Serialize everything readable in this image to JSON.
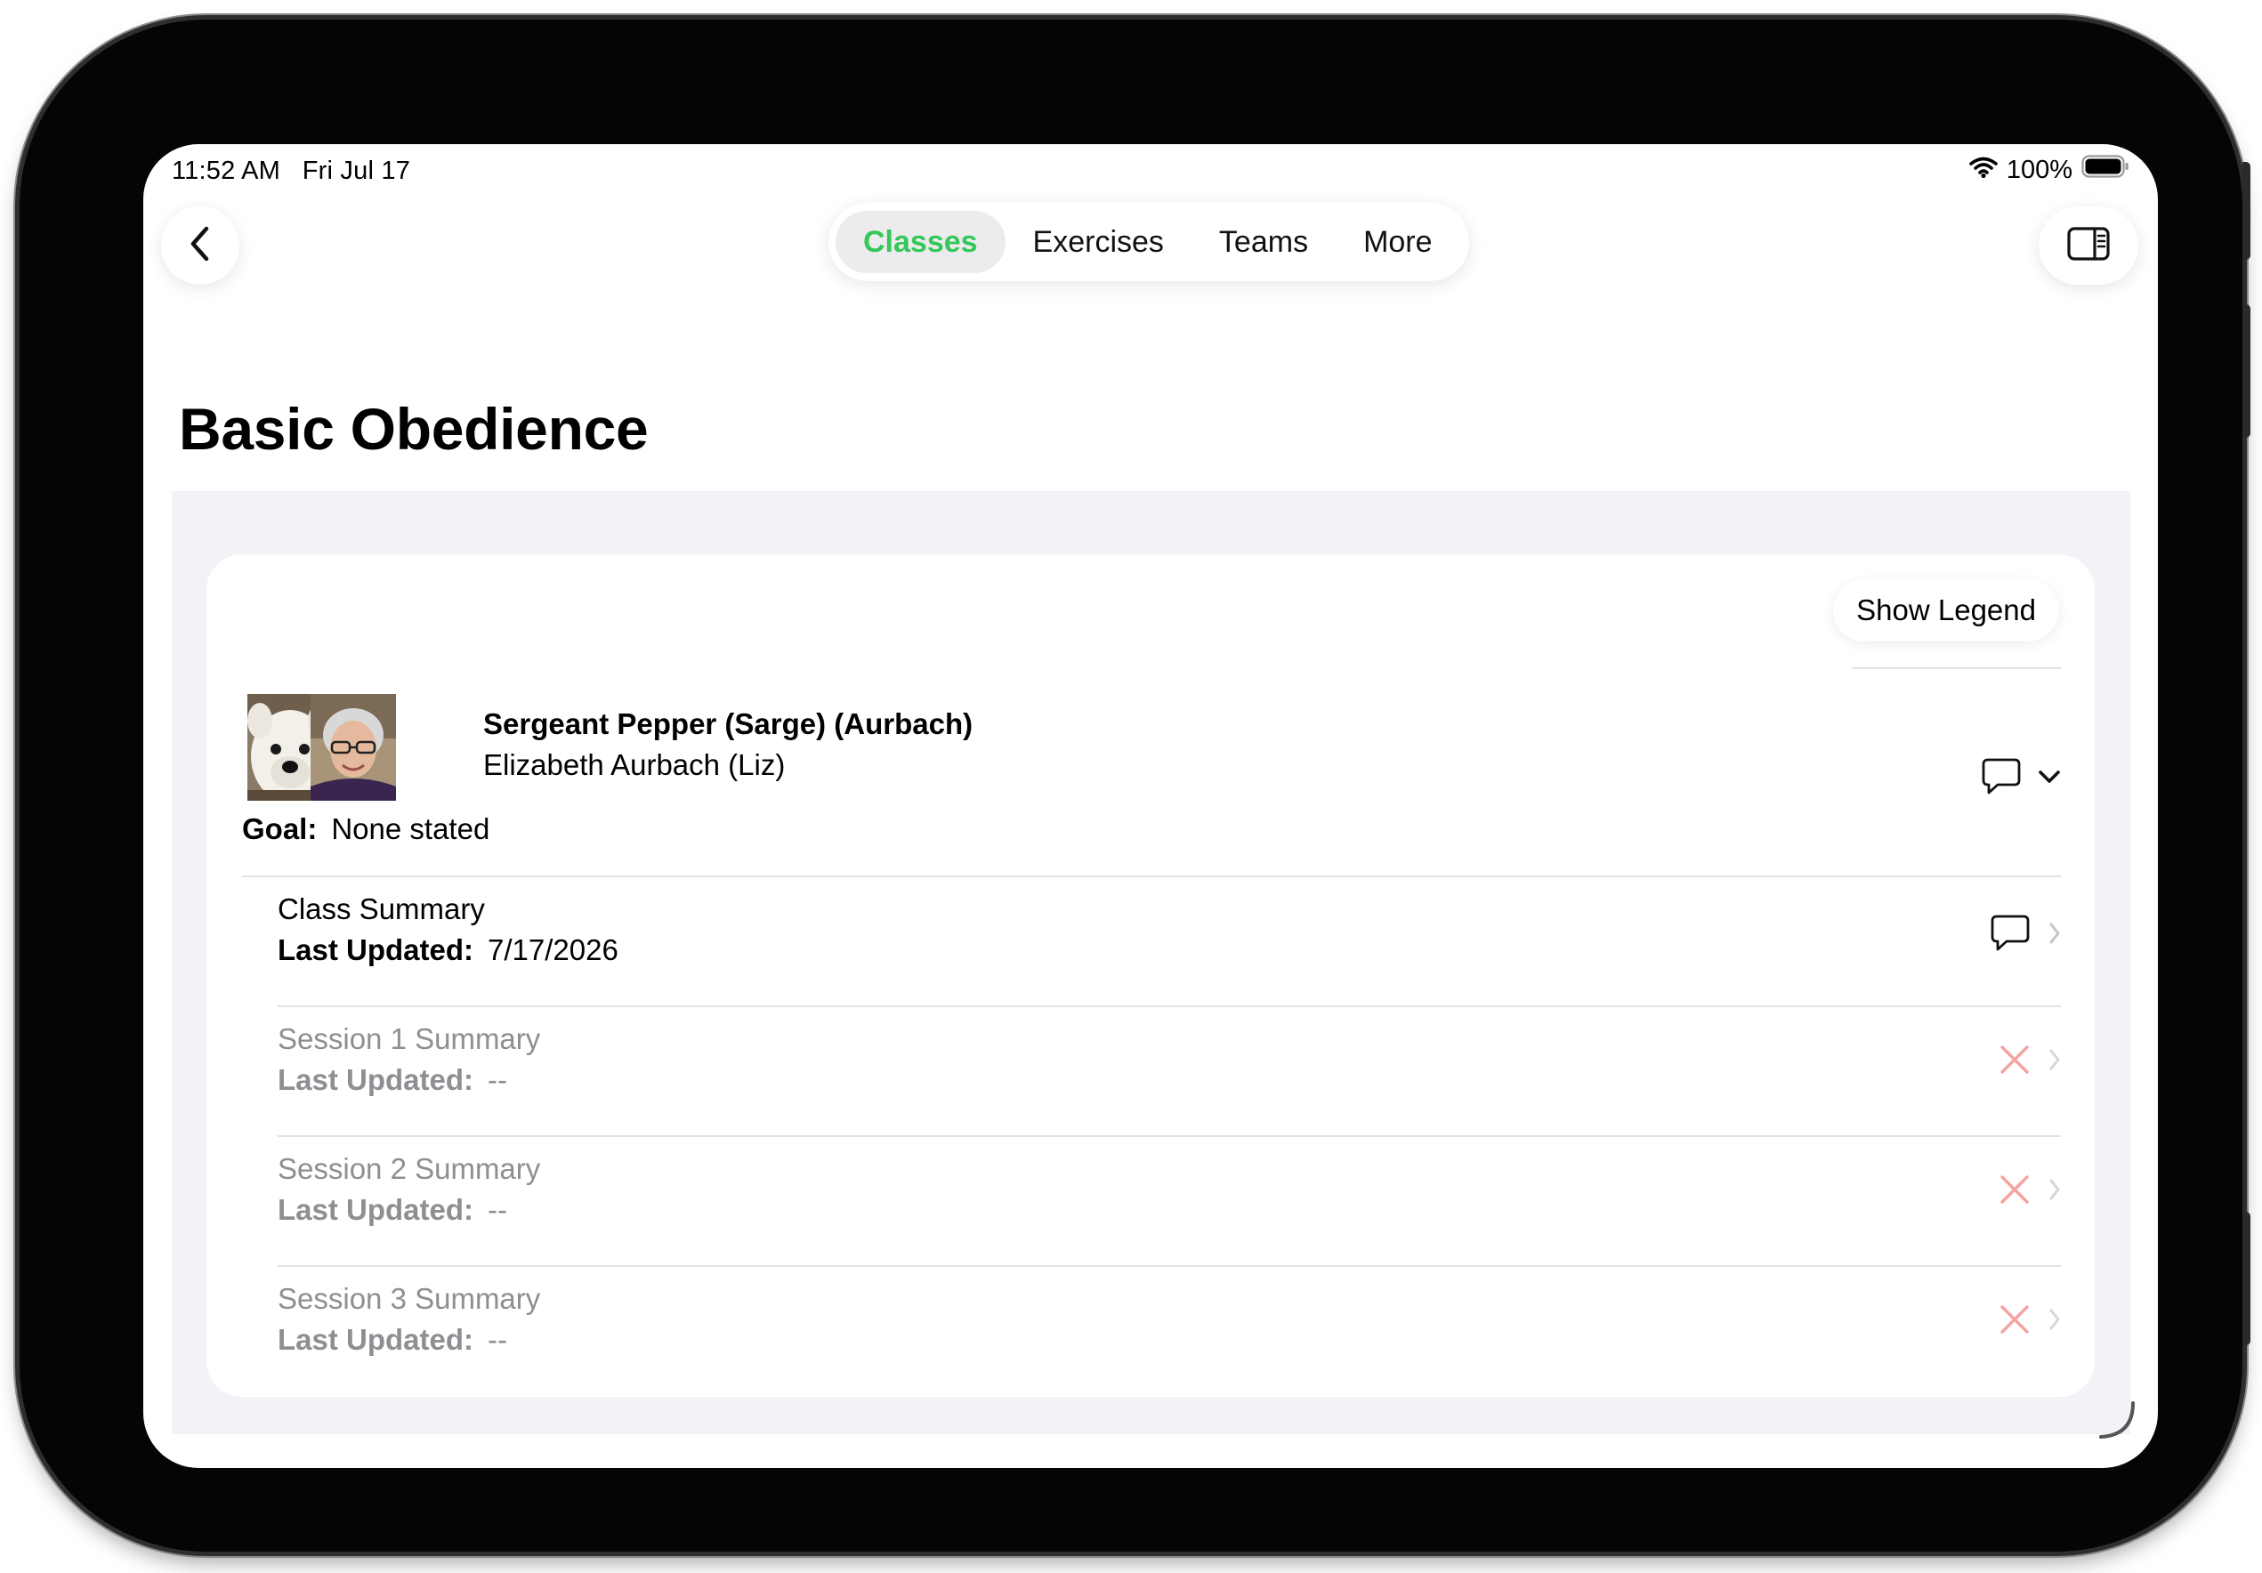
{
  "status_bar": {
    "time": "11:52 AM",
    "date": "Fri Jul 17",
    "battery": "100%"
  },
  "nav": {
    "tabs": [
      {
        "label": "Classes",
        "active": true
      },
      {
        "label": "Exercises",
        "active": false
      },
      {
        "label": "Teams",
        "active": false
      },
      {
        "label": "More",
        "active": false
      }
    ]
  },
  "page": {
    "title": "Basic Obedience"
  },
  "card": {
    "legend_button": "Show Legend",
    "team": {
      "dog_name": "Sergeant Pepper (Sarge) (Aurbach)",
      "handler": "Elizabeth Aurbach  (Liz)",
      "goal_label": "Goal:",
      "goal_value": "None stated"
    },
    "summaries": [
      {
        "title": "Class Summary",
        "updated_label": "Last Updated:",
        "updated_value": "7/17/2026",
        "status": "comment"
      },
      {
        "title": "Session 1 Summary",
        "updated_label": "Last Updated:",
        "updated_value": "--",
        "status": "missing"
      },
      {
        "title": "Session 2 Summary",
        "updated_label": "Last Updated:",
        "updated_value": "--",
        "status": "missing"
      },
      {
        "title": "Session 3 Summary",
        "updated_label": "Last Updated:",
        "updated_value": "--",
        "status": "missing"
      }
    ]
  },
  "colors": {
    "accent_green": "#34c759",
    "missing_red": "#f4a3a3",
    "background_gray": "#f2f2f7"
  }
}
